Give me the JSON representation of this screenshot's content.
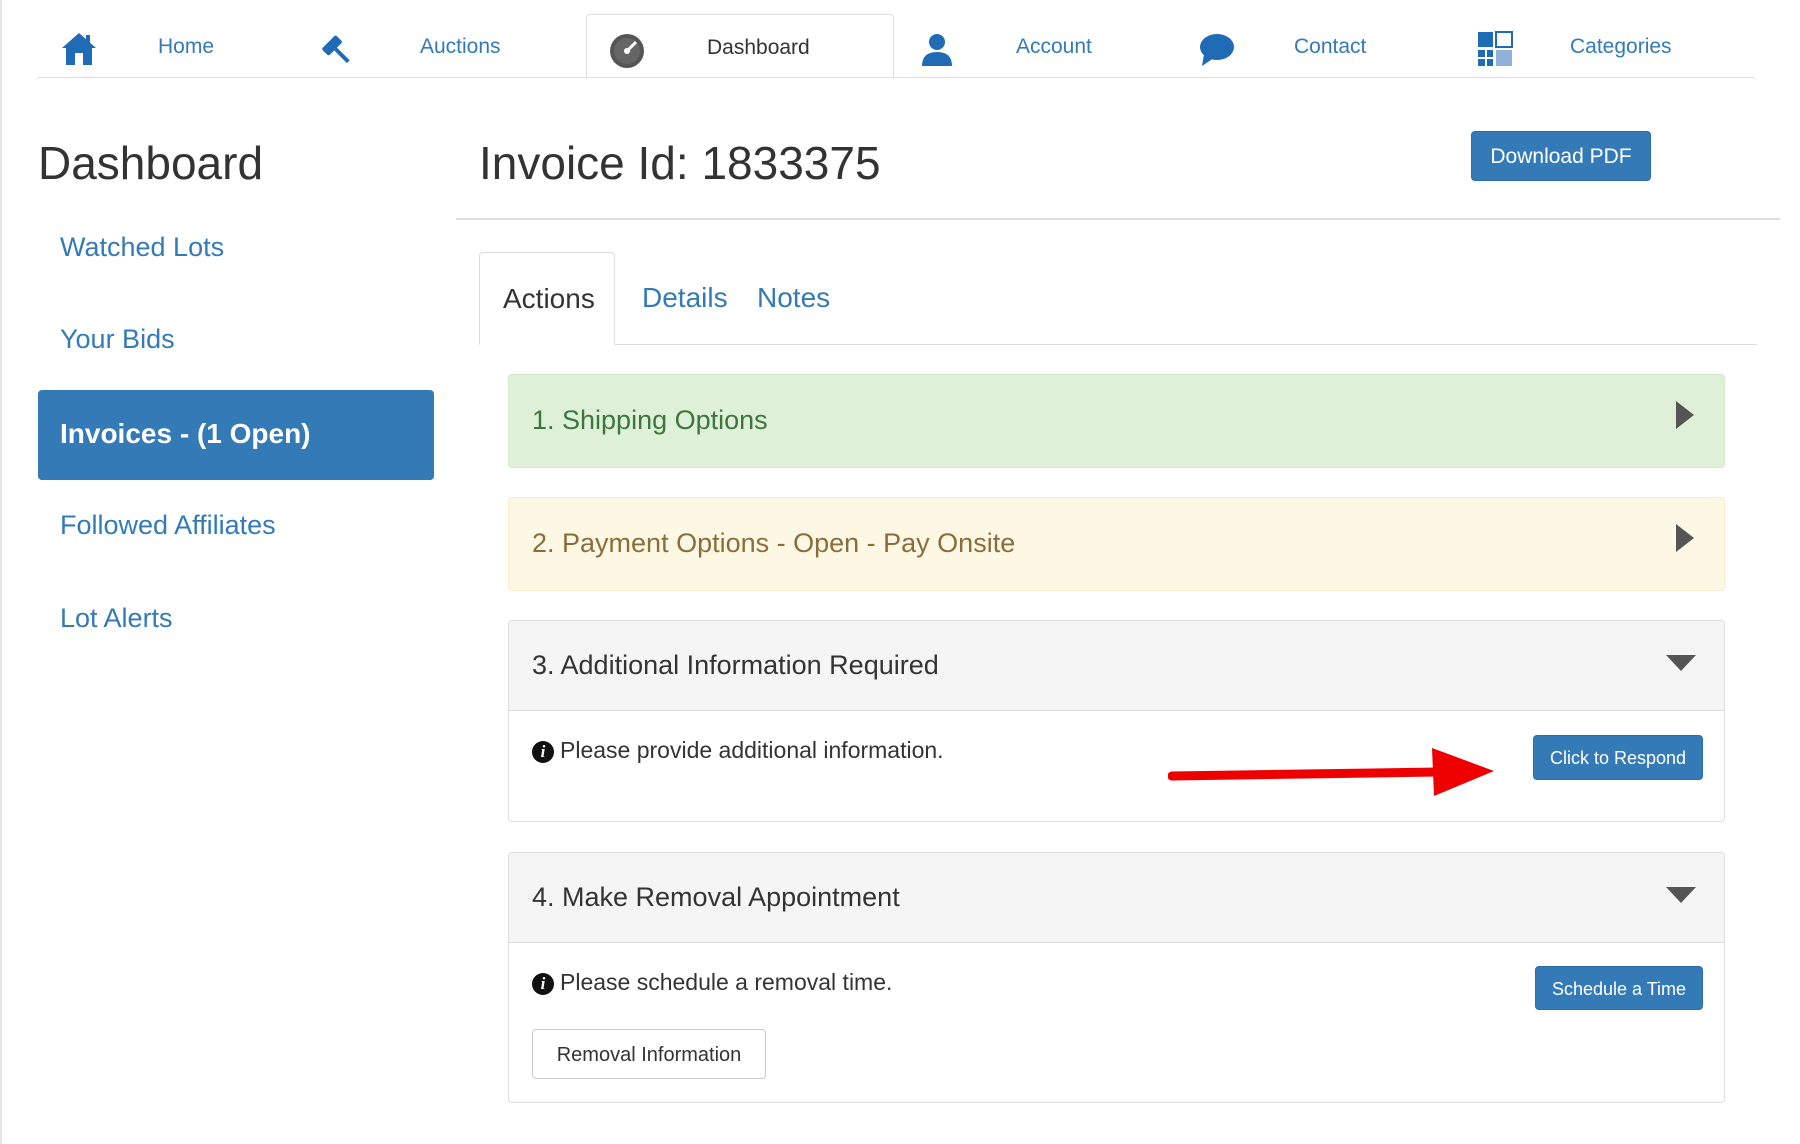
{
  "nav": {
    "items": [
      {
        "label": "Home",
        "icon": "home-icon"
      },
      {
        "label": "Auctions",
        "icon": "gavel-icon"
      },
      {
        "label": "Dashboard",
        "icon": "speedometer-icon",
        "active": true
      },
      {
        "label": "Account",
        "icon": "user-icon"
      },
      {
        "label": "Contact",
        "icon": "chat-bubble-icon"
      },
      {
        "label": "Categories",
        "icon": "grid-icon"
      }
    ]
  },
  "sidebar": {
    "title": "Dashboard",
    "items": [
      {
        "label": "Watched Lots"
      },
      {
        "label": "Your Bids"
      },
      {
        "label": "Invoices - (1 Open)",
        "active": true
      },
      {
        "label": "Followed Affiliates"
      },
      {
        "label": "Lot Alerts"
      }
    ]
  },
  "invoice": {
    "title": "Invoice Id: 1833375",
    "download_label": "Download PDF"
  },
  "tabs": [
    {
      "label": "Actions",
      "active": true
    },
    {
      "label": "Details"
    },
    {
      "label": "Notes"
    }
  ],
  "panels": {
    "shipping": {
      "title": "1. Shipping Options",
      "state": "collapsed"
    },
    "payment": {
      "title": "2. Payment Options - Open - Pay Onsite",
      "state": "collapsed"
    },
    "additional": {
      "title": "3. Additional Information Required",
      "state": "expanded",
      "message": "Please provide additional information.",
      "button_label": "Click to Respond"
    },
    "removal": {
      "title": "4. Make Removal Appointment",
      "state": "expanded",
      "message": "Please schedule a removal time.",
      "button_label": "Schedule a Time",
      "secondary_label": "Removal Information"
    }
  },
  "colors": {
    "primary": "#337ab7",
    "success_bg": "#dff0d8",
    "success_text": "#3c763d",
    "warning_bg": "#fcf8e3",
    "warning_text": "#8a6d3b",
    "annotation_arrow": "#ee0000"
  }
}
